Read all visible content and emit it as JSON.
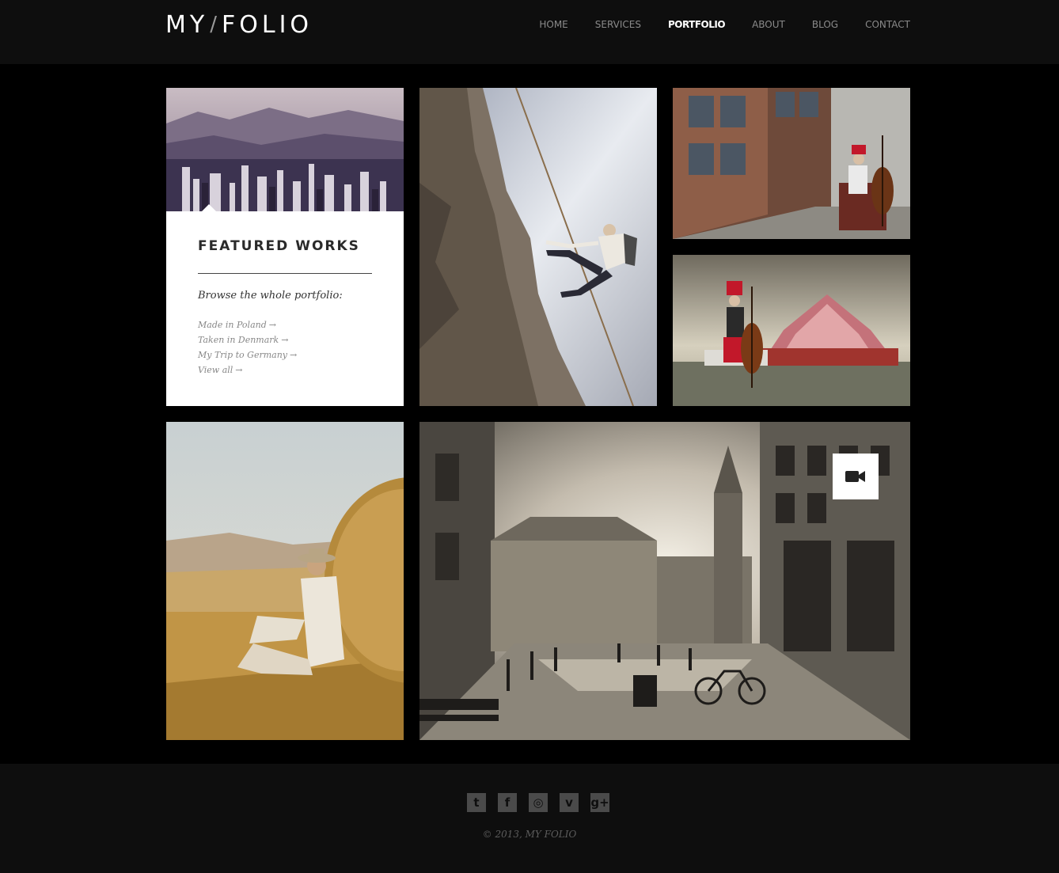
{
  "brand": {
    "logo_left": "MY",
    "logo_sep": "/",
    "logo_right": "FOLIO"
  },
  "nav": {
    "items": [
      {
        "label": "HOME"
      },
      {
        "label": "SERVICES"
      },
      {
        "label": "PORTFOLIO",
        "active": true
      },
      {
        "label": "ABOUT"
      },
      {
        "label": "BLOG"
      },
      {
        "label": "CONTACT"
      }
    ]
  },
  "featured": {
    "title": "FEATURED WORKS",
    "subtitle": "Browse the whole portfolio:",
    "links": [
      {
        "label": "Made in Poland",
        "arrow": "→"
      },
      {
        "label": "Taken in Denmark",
        "arrow": "→"
      },
      {
        "label": "My Trip to Germany",
        "arrow": "→"
      },
      {
        "label": "View all",
        "arrow": "→"
      }
    ]
  },
  "gallery": {
    "items": [
      {
        "name": "city-skyline-photo"
      },
      {
        "name": "rock-climber-photo"
      },
      {
        "name": "street-cellist-photo"
      },
      {
        "name": "circus-cellist-photo"
      },
      {
        "name": "hay-bale-photo"
      },
      {
        "name": "town-square-photo",
        "badge_icon": "video-camera-icon"
      }
    ]
  },
  "footer": {
    "social": [
      {
        "icon": "twitter-icon",
        "glyph": "t"
      },
      {
        "icon": "facebook-icon",
        "glyph": "f"
      },
      {
        "icon": "dribbble-icon",
        "glyph": "◎"
      },
      {
        "icon": "vimeo-icon",
        "glyph": "v"
      },
      {
        "icon": "google-plus-icon",
        "glyph": "g+"
      }
    ],
    "copyright": "© 2013, MY FOLIO"
  },
  "colors": {
    "background": "#000000",
    "header_bg": "#0e0e0e",
    "nav_text": "#8a8a8a",
    "nav_active": "#ffffff",
    "social_icon": "#4a4a4a"
  }
}
